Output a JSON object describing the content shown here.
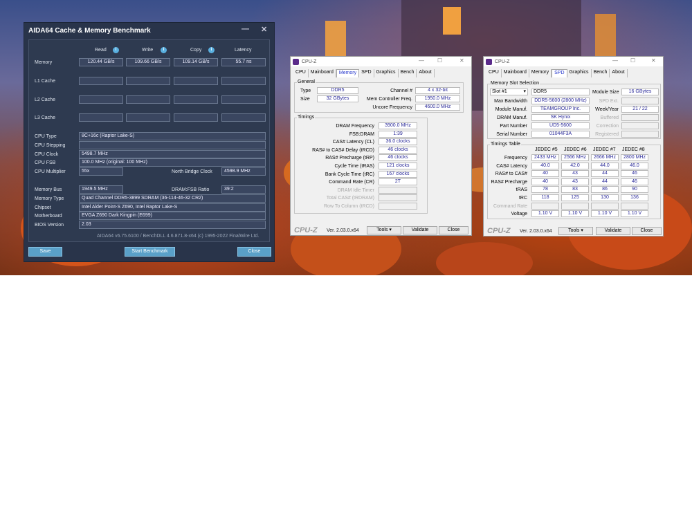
{
  "aida": {
    "title": "AIDA64 Cache & Memory Benchmark",
    "headers": {
      "read": "Read",
      "write": "Write",
      "copy": "Copy",
      "latency": "Latency"
    },
    "rows": {
      "memory": "Memory",
      "l1": "L1 Cache",
      "l2": "L2 Cache",
      "l3": "L3 Cache"
    },
    "memory": {
      "read": "120.44 GB/s",
      "write": "109.66 GB/s",
      "copy": "109.14 GB/s",
      "latency": "55.7 ns"
    },
    "info": [
      {
        "label": "CPU Type",
        "value": "8C+16c   (Raptor Lake-S)"
      },
      {
        "label": "CPU Stepping",
        "value": ""
      },
      {
        "label": "CPU Clock",
        "value": "5498.7 MHz"
      },
      {
        "label": "CPU FSB",
        "value": "100.0 MHz  (original: 100 MHz)"
      }
    ],
    "cpu_multiplier": {
      "label": "CPU Multiplier",
      "value": "55x",
      "nb_label": "North Bridge Clock",
      "nb_value": "4598.9 MHz"
    },
    "memory_bus": {
      "label": "Memory Bus",
      "value": "1949.5 MHz",
      "ratio_label": "DRAM:FSB Ratio",
      "ratio_value": "39:2"
    },
    "info2": [
      {
        "label": "Memory Type",
        "value": "Quad Channel DDR5-3899 SDRAM  (36-114-46-32 CR2)"
      },
      {
        "label": "Chipset",
        "value": "Intel Alder Point-S Z690, Intel Raptor Lake-S"
      },
      {
        "label": "Motherboard",
        "value": "EVGA Z690 Dark Kingpin (E699)"
      },
      {
        "label": "BIOS Version",
        "value": "2.03"
      }
    ],
    "footer": "AIDA64 v6.75.6100 / BenchDLL 4.6.871.8-x64  (c) 1995-2022 FinalWire Ltd.",
    "buttons": {
      "save": "Save",
      "start": "Start Benchmark",
      "close": "Close"
    }
  },
  "cpuz1": {
    "title": "CPU-Z",
    "tabs": [
      "CPU",
      "Mainboard",
      "Memory",
      "SPD",
      "Graphics",
      "Bench",
      "About"
    ],
    "general_title": "General",
    "type_label": "Type",
    "type": "DDR5",
    "size_label": "Size",
    "size": "32 GBytes",
    "channel_label": "Channel #",
    "channel": "4 x 32-bit",
    "mc_label": "Mem Controller Freq.",
    "mc": "1950.0 MHz",
    "uncore_label": "Uncore Frequency",
    "uncore": "4600.0 MHz",
    "timings_title": "Timings",
    "timings": [
      {
        "label": "DRAM Frequency",
        "value": "3900.0 MHz"
      },
      {
        "label": "FSB:DRAM",
        "value": "1:39"
      },
      {
        "label": "CAS# Latency (CL)",
        "value": "36.0 clocks"
      },
      {
        "label": "RAS# to CAS# Delay (tRCD)",
        "value": "46 clocks"
      },
      {
        "label": "RAS# Precharge (tRP)",
        "value": "46 clocks"
      },
      {
        "label": "Cycle Time (tRAS)",
        "value": "121 clocks"
      },
      {
        "label": "Bank Cycle Time (tRC)",
        "value": "167 clocks"
      },
      {
        "label": "Command Rate (CR)",
        "value": "2T"
      },
      {
        "label": "DRAM Idle Timer",
        "value": ""
      },
      {
        "label": "Total CAS# (tRDRAM)",
        "value": ""
      },
      {
        "label": "Row To Column (tRCD)",
        "value": ""
      }
    ],
    "logo": "CPU-Z",
    "version": "Ver. 2.03.0.x64",
    "tools": "Tools",
    "validate": "Validate",
    "close": "Close"
  },
  "cpuz2": {
    "title": "CPU-Z",
    "tabs": [
      "CPU",
      "Mainboard",
      "Memory",
      "SPD",
      "Graphics",
      "Bench",
      "About"
    ],
    "slot_title": "Memory Slot Selection",
    "slot": "Slot #1",
    "type": "DDR5",
    "module_size_label": "Module Size",
    "module_size": "16 GBytes",
    "max_bw_label": "Max Bandwidth",
    "max_bw": "DDR5-5600 (2800 MHz)",
    "spd_ext_label": "SPD Ext.",
    "manuf_label": "Module Manuf.",
    "manuf": "TEAMGROUP Inc.",
    "week_label": "Week/Year",
    "week": "21 / 22",
    "dram_manuf_label": "DRAM Manuf.",
    "dram_manuf": "SK Hynix",
    "buffered_label": "Buffered",
    "part_label": "Part Number",
    "part": "UD5-5600",
    "correction_label": "Correction",
    "serial_label": "Serial Number",
    "serial": "01044F3A",
    "registered_label": "Registered",
    "timings_title": "Timings Table",
    "cols": [
      "JEDEC #5",
      "JEDEC #6",
      "JEDEC #7",
      "JEDEC #8"
    ],
    "rows": [
      {
        "label": "Frequency",
        "values": [
          "2433 MHz",
          "2566 MHz",
          "2666 MHz",
          "2800 MHz"
        ]
      },
      {
        "label": "CAS# Latency",
        "values": [
          "40.0",
          "42.0",
          "44.0",
          "46.0"
        ]
      },
      {
        "label": "RAS# to CAS#",
        "values": [
          "40",
          "43",
          "44",
          "46"
        ]
      },
      {
        "label": "RAS# Precharge",
        "values": [
          "40",
          "43",
          "44",
          "46"
        ]
      },
      {
        "label": "tRAS",
        "values": [
          "78",
          "83",
          "86",
          "90"
        ]
      },
      {
        "label": "tRC",
        "values": [
          "118",
          "125",
          "130",
          "136"
        ]
      },
      {
        "label": "Command Rate",
        "values": [
          "",
          "",
          "",
          ""
        ]
      },
      {
        "label": "Voltage",
        "values": [
          "1.10 V",
          "1.10 V",
          "1.10 V",
          "1.10 V"
        ]
      }
    ],
    "logo": "CPU-Z",
    "version": "Ver. 2.03.0.x64",
    "tools": "Tools",
    "validate": "Validate",
    "close": "Close"
  }
}
